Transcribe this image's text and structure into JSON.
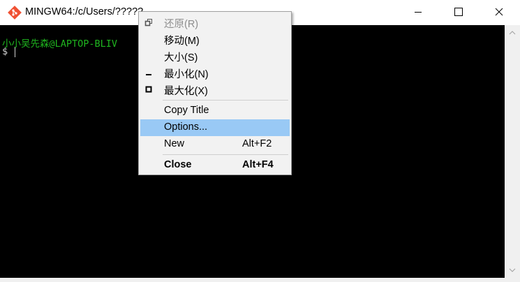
{
  "window": {
    "title": "MINGW64:/c/Users/?????"
  },
  "console": {
    "user_line": "小小吴先森@LAPTOP-BLIV",
    "prompt": "$"
  },
  "context_menu": {
    "items": [
      {
        "label": "还原(R)",
        "shortcut": "",
        "icon": "restore-icon",
        "disabled": true
      },
      {
        "label": "移动(M)",
        "shortcut": ""
      },
      {
        "label": "大小(S)",
        "shortcut": ""
      },
      {
        "label": "最小化(N)",
        "shortcut": "",
        "icon": "minimize-icon"
      },
      {
        "label": "最大化(X)",
        "shortcut": "",
        "icon": "maximize-icon"
      },
      {
        "label": "Copy Title",
        "shortcut": ""
      },
      {
        "label": "Options...",
        "shortcut": "",
        "highlighted": true
      },
      {
        "label": "New",
        "shortcut": "Alt+F2"
      },
      {
        "label": "Close",
        "shortcut": "Alt+F4",
        "bold": true
      }
    ]
  },
  "colors": {
    "menu_highlight": "#99c9f5",
    "prompt_green": "#1fb51f",
    "console_bg": "#000000"
  }
}
